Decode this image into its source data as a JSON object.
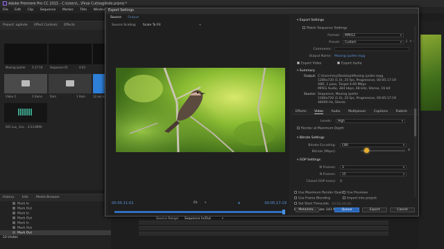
{
  "app": {
    "title": "Adobe Premiere Pro CC 2015 - C:\\Users\\...\\Final Cuts\\oglinde.prproj *",
    "menu": [
      "File",
      "Edit",
      "Clip",
      "Sequence",
      "Marker",
      "Title",
      "Window",
      "Help"
    ]
  },
  "project": {
    "tabs": [
      "Project: oglinde",
      "Effect Controls",
      "Effects"
    ],
    "items": [
      {
        "name": "Mooing (poller",
        "meta": "5:17:19"
      },
      {
        "name": "Sequence 01",
        "meta": "4:03"
      },
      {
        "name": "",
        "meta": ""
      },
      {
        "name": "Video 2",
        "meta": "3 Items"
      },
      {
        "name": "Ram",
        "meta": "1 Item"
      },
      {
        "name": "12.avi.mov",
        "meta": ""
      },
      {
        "name": "001 Lux_ Gro...",
        "meta": "4:22:8990"
      }
    ]
  },
  "history": {
    "tabs": [
      "History",
      "Info",
      "Media Browser"
    ],
    "items": [
      "Mark In",
      "Mark Out",
      "Mark In",
      "Mark Out",
      "Mark In",
      "Mark Out",
      "Mark Out"
    ],
    "selected_index": 6,
    "count_label": "23 Undos"
  },
  "dialog": {
    "title": "Export Settings",
    "source_tabs": [
      "Source",
      "Output"
    ],
    "source_scaling_label": "Source Scaling:",
    "source_scaling_value": "Scale To Fit",
    "timecode_in": "00:05:11:01",
    "timecode_out": "00:05:17:19",
    "fit_value": "Fit",
    "source_range_label": "Source Range:",
    "source_range_value": "Sequence In/Out",
    "export_settings": {
      "header": "Export Settings",
      "match_sequence": "Match Sequence Settings",
      "format_label": "Format:",
      "format_value": "MPEG2",
      "preset_label": "Preset:",
      "preset_value": "Custom",
      "comments_label": "Comments:",
      "output_name_label": "Output Name:",
      "output_name_value": "Mooing (poller.mpg",
      "export_video": "Export Video",
      "export_audio": "Export Audio"
    },
    "summary": {
      "header": "Summary",
      "output_label": "Output:",
      "output_lines": [
        "C:\\Users\\my\\Desktop\\Mooing (poller.mpg",
        "1280x720 (1.0), 25 fps, Progressive, 00:05:17:19",
        "VBR, 1 pass, Target 4.00 Mbps",
        "MPEG Audio, 384 kbps, 48 kHz, Stereo, 16 bit"
      ],
      "source_label": "Source:",
      "source_lines": [
        "Sequence, Mooing (poller",
        "1280x720 (1.0), 25 fps, Progressive, 00:05:17:19",
        "48000 Hz, Stereo"
      ]
    },
    "format_tabs": [
      "Effects",
      "Video",
      "Audio",
      "Multiplexer",
      "Captions",
      "Publish"
    ],
    "format_tab_active": 1,
    "levels_label": "Levels:",
    "levels_value": "High",
    "render_max_depth": "Render at Maximum Depth",
    "bitrate": {
      "header": "Bitrate Settings",
      "encoding_label": "Bitrate Encoding:",
      "encoding_value": "CBR",
      "bitrate_label": "Bitrate [Mbps]:",
      "bitrate_value": "4"
    },
    "gop": {
      "header": "GOP Settings",
      "m_frames_label": "M Frames:",
      "m_frames_value": "3",
      "n_frames_label": "N Frames:",
      "n_frames_value": "15",
      "closed_gop_label": "Closed GOP every:",
      "closed_gop_value": "0"
    },
    "options": {
      "max_render_quality": "Use Maximum Render Quality",
      "use_previews": "Use Previews",
      "frame_blending": "Use Frame Blending",
      "import_into_project": "Import into project",
      "set_start_timecode": "Set Start Timecode",
      "start_timecode_value": "00:00:00:00"
    },
    "file_size_label": "Estimated File Size:",
    "file_size_value": "141 MB",
    "buttons": {
      "metadata": "Metadata...",
      "queue": "Queue",
      "export": "Export",
      "cancel": "Cancel"
    }
  }
}
